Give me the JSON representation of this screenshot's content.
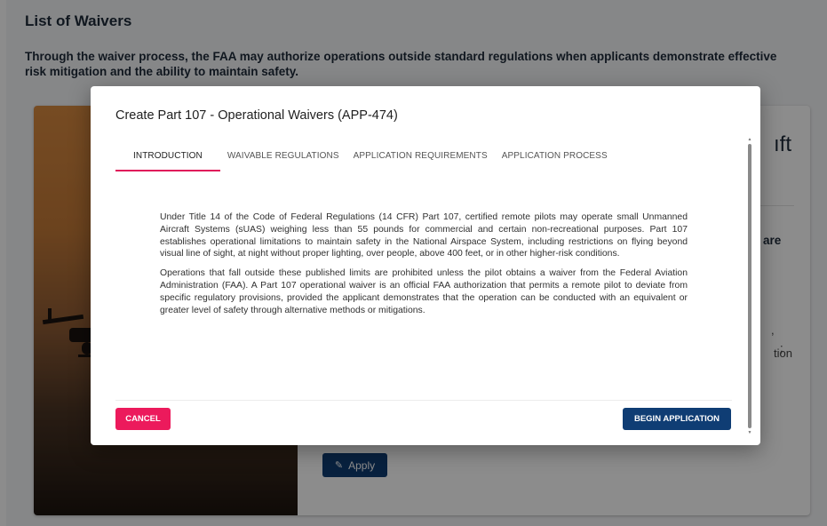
{
  "page": {
    "title": "List of Waivers",
    "intro": "Through the waiver process, the FAA may authorize operations outside standard regulations when applicants demonstrate effective risk mitigation and the ability to maintain safety."
  },
  "card": {
    "heading_fragment": "ıft",
    "subheading_fragment": "are",
    "text_fragment_a": ",",
    "text_fragment_b": ";",
    "text_fragment_c": "tion",
    "apply_label": "Apply",
    "apply_icon": "pencil-icon"
  },
  "modal": {
    "title": "Create Part 107 - Operational Waivers (APP-474)",
    "tabs": [
      {
        "label": "INTRODUCTION",
        "active": true
      },
      {
        "label": "WAIVABLE REGULATIONS",
        "active": false
      },
      {
        "label": "APPLICATION REQUIREMENTS",
        "active": false
      },
      {
        "label": "APPLICATION PROCESS",
        "active": false
      }
    ],
    "paragraphs": [
      "Under Title 14 of the Code of Federal Regulations (14 CFR) Part 107, certified remote pilots may operate small Unmanned Aircraft Systems (sUAS) weighing less than 55 pounds for commercial and certain non-recreational purposes. Part 107 establishes operational limitations to maintain safety in the National Airspace System, including restrictions on flying beyond visual line of sight, at night without proper lighting, over people, above 400 feet, or in other higher-risk conditions.",
      "Operations that fall outside these published limits are prohibited unless the pilot obtains a waiver from the Federal Aviation Administration (FAA). A Part 107 operational waiver is an official FAA authorization that permits a remote pilot to deviate from specific regulatory provisions, provided the applicant demonstrates that the operation can be conducted with an equivalent or greater level of safety through alternative methods or mitigations."
    ],
    "cancel_label": "CANCEL",
    "begin_label": "BEGIN APPLICATION"
  },
  "colors": {
    "primary": "#0f3d74",
    "accent": "#ec1a5c",
    "tab_indicator": "#e0195a"
  }
}
